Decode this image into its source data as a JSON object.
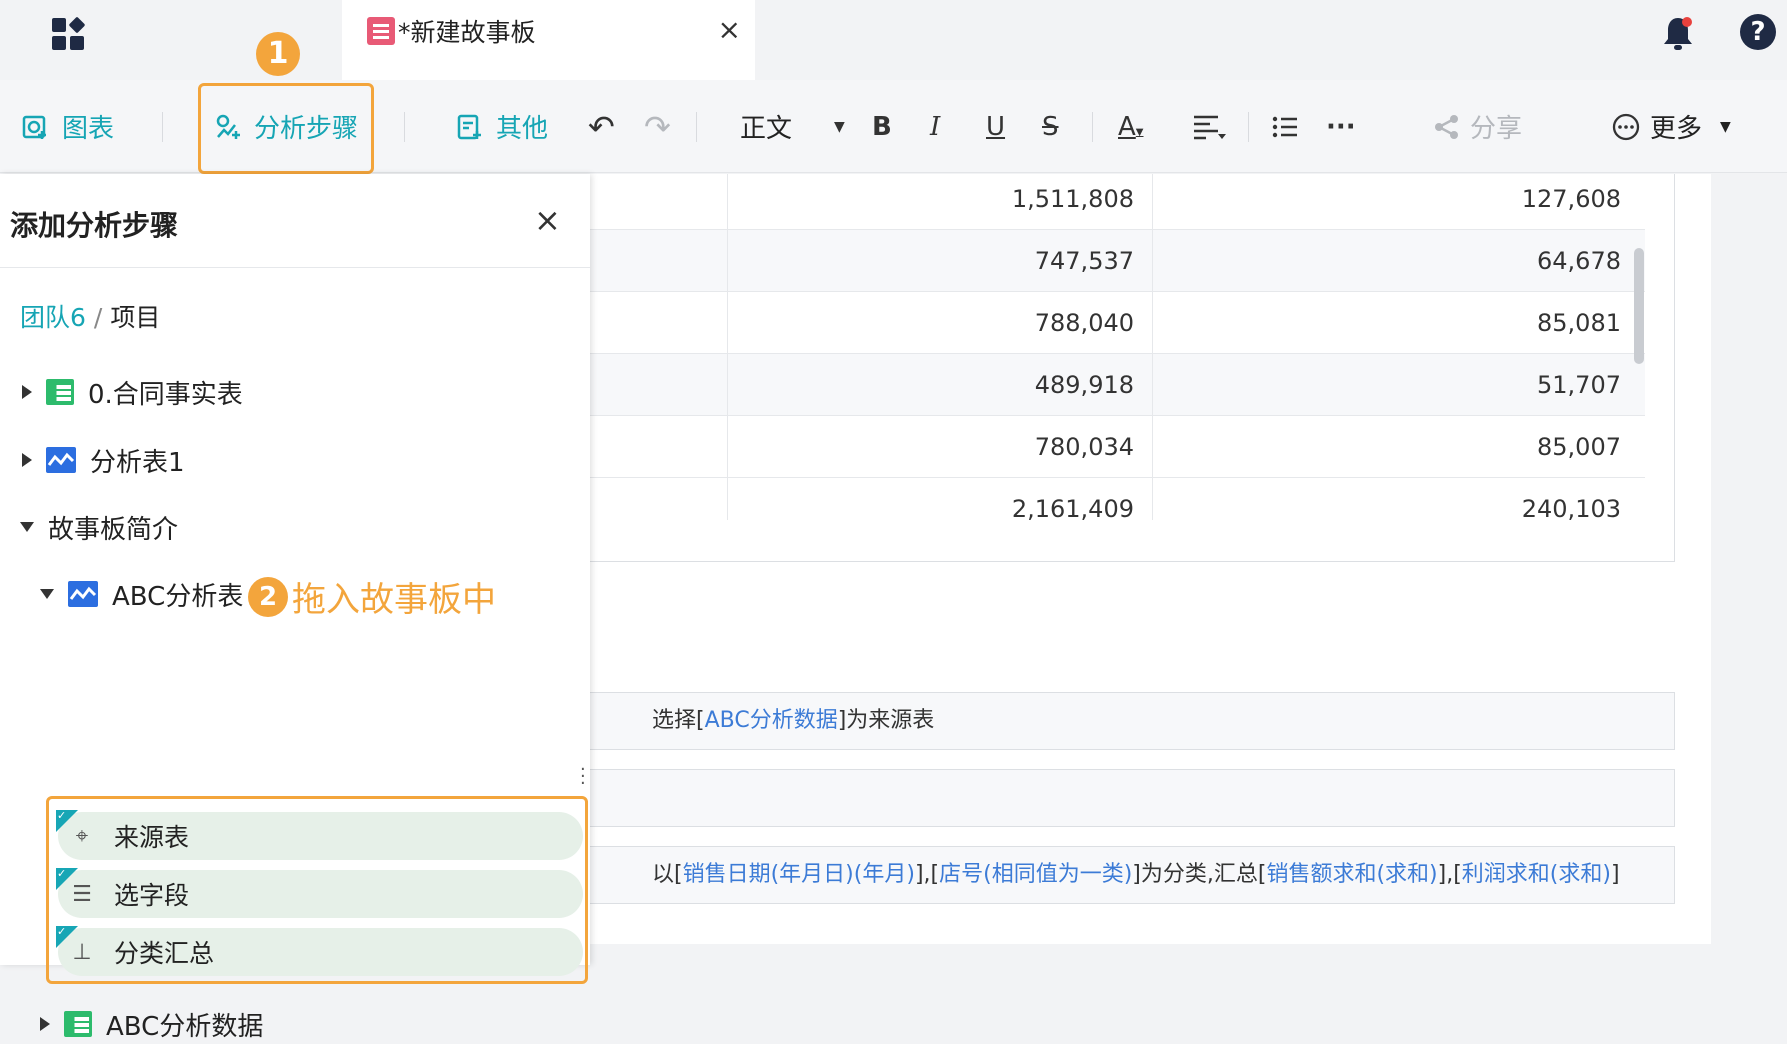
{
  "topbar": {
    "tab_title": "*新建故事板",
    "tab_close": "×",
    "help_label": "?"
  },
  "toolbar": {
    "chart_label": "图表",
    "analysis_steps_label": "分析步骤",
    "other_label": "其他",
    "undo": "↶",
    "redo": "↷",
    "text_style": "正文",
    "bold": "B",
    "italic": "I",
    "underline": "U",
    "strike": "S",
    "font_color": "A",
    "more_dots": "···",
    "share_label": "分享",
    "more_label": "更多"
  },
  "annotations": {
    "step1": "1",
    "step2": "2",
    "step2_text": "拖入故事板中"
  },
  "panel": {
    "title": "添加分析步骤",
    "close": "×",
    "breadcrumb": {
      "team": "团队6",
      "separator": "/",
      "project": "项目"
    },
    "tree": [
      {
        "label": "0.合同事实表",
        "type": "table",
        "expanded": false
      },
      {
        "label": "分析表1",
        "type": "analysis",
        "expanded": false
      },
      {
        "label": "故事板简介",
        "type": "folder",
        "expanded": true
      },
      {
        "label": "ABC分析表",
        "type": "analysis",
        "expanded": true
      },
      {
        "label": "ABC分析数据",
        "type": "table",
        "expanded": false
      }
    ],
    "steps": [
      {
        "label": "来源表",
        "icon": "crosshair-icon"
      },
      {
        "label": "选字段",
        "icon": "field-select-icon"
      },
      {
        "label": "分类汇总",
        "icon": "hierarchy-icon"
      }
    ]
  },
  "table": {
    "rows": [
      [
        "1,511,808",
        "127,608"
      ],
      [
        "747,537",
        "64,678"
      ],
      [
        "788,040",
        "85,081"
      ],
      [
        "489,918",
        "51,707"
      ],
      [
        "780,034",
        "85,007"
      ],
      [
        "2,161,409",
        "240,103"
      ]
    ]
  },
  "step_descriptions": {
    "source": {
      "prefix": "选择[",
      "link": "ABC分析数据",
      "suffix": "]为来源表"
    },
    "group": {
      "p1": "以[",
      "l1": "销售日期(年月日)(年月)",
      "p2": "],[",
      "l2": "店号(相同值为一类)",
      "p3": "]为分类,汇总[",
      "l3": "销售额求和(求和)",
      "p4": "],[",
      "l4": "利润求和(求和)",
      "p5": "]"
    }
  },
  "colors": {
    "accent_teal": "#16a5b4",
    "highlight_orange": "#f3a53c",
    "link_blue": "#3c7bd6"
  }
}
